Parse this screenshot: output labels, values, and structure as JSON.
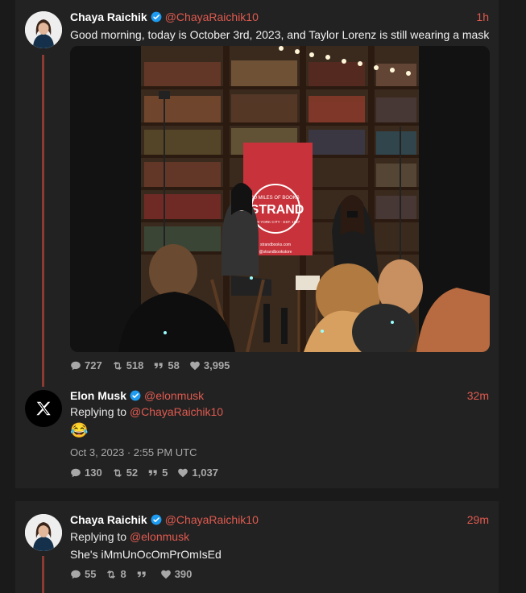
{
  "tweets": [
    {
      "name": "Chaya Raichik",
      "handle": "@ChayaRaichik10",
      "time": "1h",
      "text": "Good morning, today is October 3rd, 2023, and Taylor Lorenz is still wearing a mask",
      "media": {
        "banner_top": "10 MILES OF BOOKS",
        "banner_brand": "STRAND",
        "banner_sub": "NEW YORK CITY · EST. 1927",
        "banner_url": "strandbooks.com",
        "banner_handle": "@strandbookstore"
      },
      "stats": {
        "replies": "727",
        "retweets": "518",
        "quotes": "58",
        "likes": "3,995"
      }
    },
    {
      "name": "Elon Musk",
      "handle": "@elonmusk",
      "time": "32m",
      "replying_label": "Replying to",
      "replying_to": "@ChayaRaichik10",
      "text": "😂",
      "date": "Oct 3, 2023 · 2:55 PM UTC",
      "stats": {
        "replies": "130",
        "retweets": "52",
        "quotes": "5",
        "likes": "1,037"
      }
    },
    {
      "name": "Chaya Raichik",
      "handle": "@ChayaRaichik10",
      "time": "29m",
      "replying_label": "Replying to",
      "replying_to": "@elonmusk",
      "text": "She's iMmUnOcOmPrOmIsEd",
      "stats": {
        "replies": "55",
        "retweets": "8",
        "quotes": "",
        "likes": "390"
      }
    }
  ],
  "colors": {
    "accent": "#e05a4f",
    "verified": "#1d9bf0",
    "thread_line": "#8b3a32"
  },
  "icons": [
    "verified-badge-icon",
    "reply-icon",
    "retweet-icon",
    "quote-icon",
    "like-icon",
    "x-logo-icon"
  ]
}
